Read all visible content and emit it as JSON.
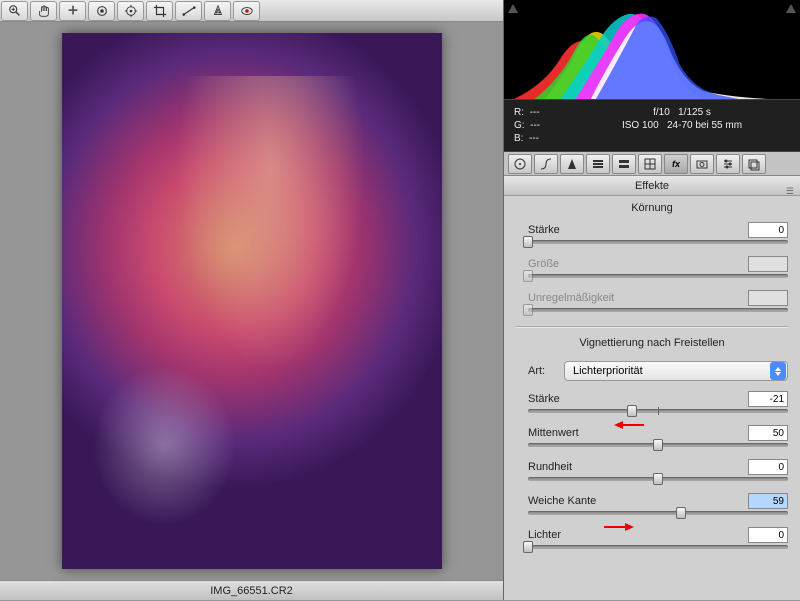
{
  "filename": "IMG_66551.CR2",
  "exif": {
    "r": "R:",
    "g": "G:",
    "b": "B:",
    "rval": "---",
    "gval": "---",
    "bval": "---",
    "line1a": "f/10",
    "line1b": "1/125 s",
    "line2a": "ISO 100",
    "line2b": "24-70 bei 55 mm"
  },
  "panelTitle": "Effekte",
  "grain": {
    "title": "Körnung",
    "strength": {
      "label": "Stärke",
      "value": "0",
      "pos": 0
    },
    "size": {
      "label": "Größe",
      "value": "",
      "pos": 0
    },
    "rough": {
      "label": "Unregelmäßigkeit",
      "value": "",
      "pos": 0
    }
  },
  "vignette": {
    "title": "Vignettierung nach Freistellen",
    "artLabel": "Art:",
    "artValue": "Lichterpriorität",
    "strength": {
      "label": "Stärke",
      "value": "-21",
      "pos": 40
    },
    "midpoint": {
      "label": "Mittenwert",
      "value": "50",
      "pos": 50
    },
    "roundness": {
      "label": "Rundheit",
      "value": "0",
      "pos": 50
    },
    "feather": {
      "label": "Weiche Kante",
      "value": "59",
      "pos": 59
    },
    "highlights": {
      "label": "Lichter",
      "value": "0",
      "pos": 0
    }
  }
}
